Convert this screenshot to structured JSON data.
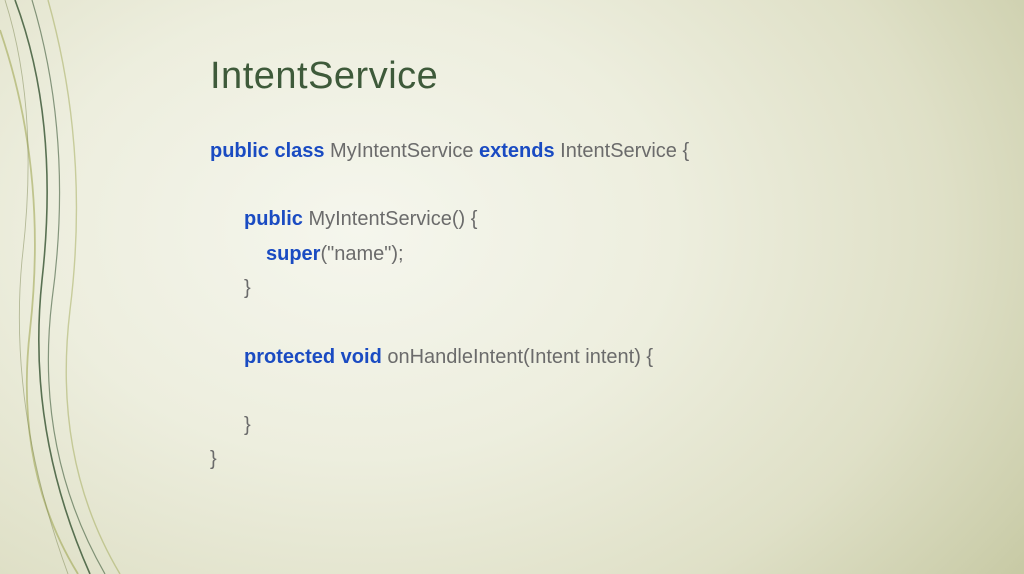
{
  "title": "IntentService",
  "code": {
    "l1": {
      "kw1": "public class",
      "t1": " MyIntentService ",
      "kw2": "extends",
      "t2": " IntentService {"
    },
    "l2": {
      "kw1": "public",
      "t1": " MyIntentService() {"
    },
    "l3": {
      "kw1": "super",
      "t1": "(\"name\");"
    },
    "l4": {
      "t1": "}"
    },
    "l5": {
      "kw1": "protected void",
      "t1": " onHandleIntent(Intent intent) {"
    },
    "l6": {
      "t1": "}"
    },
    "l7": {
      "t1": "}"
    }
  }
}
